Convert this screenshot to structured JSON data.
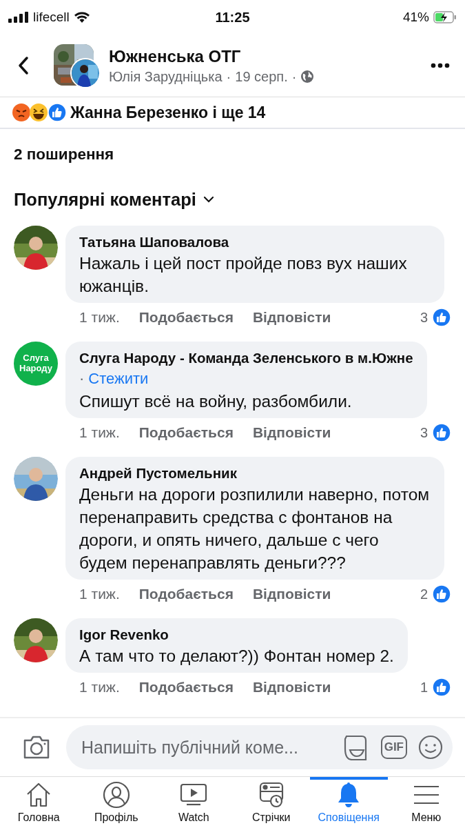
{
  "status_bar": {
    "carrier": "lifecell",
    "time": "11:25",
    "battery": "41%"
  },
  "header": {
    "title": "Южненська ОТГ",
    "author": "Юлія Зарудніцька",
    "date": "19 серп.",
    "separator": "·"
  },
  "reactions": {
    "text": "Жанна Березенко і ще 14"
  },
  "shares": "2 поширення",
  "sort": {
    "label": "Популярні коментарі"
  },
  "comments": [
    {
      "name": "Татьяна Шаповалова",
      "text": "Нажаль і цей пост пройде повз вух наших южанців.",
      "time": "1 тиж.",
      "like": "Подобається",
      "reply": "Відповісти",
      "likes": "3"
    },
    {
      "avatar": {
        "kind": "text",
        "label": "Слуга Народу",
        "color": "#10b14b"
      },
      "name": "Слуга Народу - Команда Зеленського в м.Южне",
      "follow": {
        "dot": "·",
        "label": "Стежити"
      },
      "text": "Спишут всё на войну, разбомбили.",
      "time": "1 тиж.",
      "like": "Подобається",
      "reply": "Відповісти",
      "likes": "3"
    },
    {
      "name": "Андрей Пустомельник",
      "text": "Деньги на дороги розпилили наверно, потом перенаправить средства с фонтанов на дороги, и опять ничего, дальше с чего будем перенаправлять деньги???",
      "time": "1 тиж.",
      "like": "Подобається",
      "reply": "Відповісти",
      "likes": "2"
    },
    {
      "name": "Igor Revenko",
      "text": "А там что то делают?)) Фонтан номер 2.",
      "time": "1 тиж.",
      "like": "Подобається",
      "reply": "Відповісти",
      "likes": "1"
    }
  ],
  "composer": {
    "placeholder": "Напишіть публічний коме...",
    "gif": "GIF"
  },
  "nav": [
    {
      "label": "Головна",
      "kind": "home",
      "selected": false
    },
    {
      "label": "Профіль",
      "kind": "profile",
      "selected": false
    },
    {
      "label": "Watch",
      "kind": "watch",
      "selected": false
    },
    {
      "label": "Стрічки",
      "kind": "feeds",
      "selected": false
    },
    {
      "label": "Сповіщення",
      "kind": "bell",
      "selected": true
    },
    {
      "label": "Меню",
      "kind": "menu",
      "selected": false
    }
  ]
}
